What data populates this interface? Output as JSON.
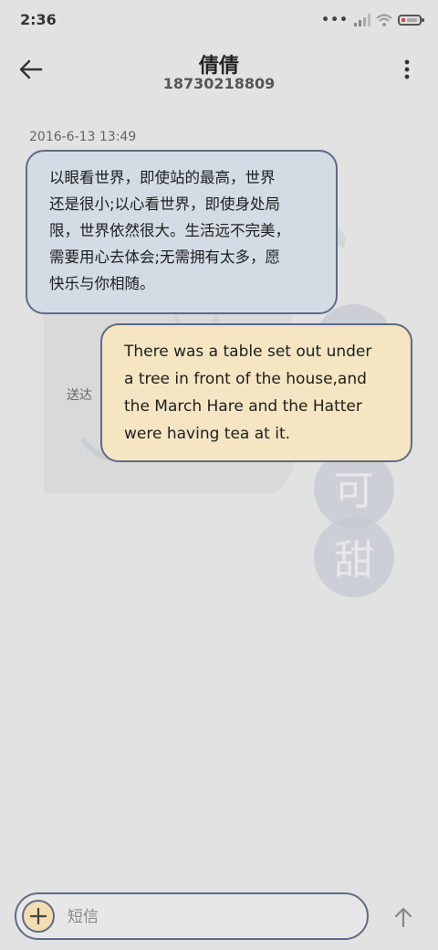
{
  "status_bar": {
    "time": "2:36"
  },
  "header": {
    "contact_name": "倩倩",
    "contact_number": "18730218809"
  },
  "conversation": {
    "timestamp": "2016-6-13 13:49",
    "messages": [
      {
        "direction": "incoming",
        "text": "以眼看世界，即使站的最高，世界\n还是很小;以心看世界，即使身处局\n限，世界依然很大。生活远不完美，\n需要用心去体会;无需拥有太多，愿\n快乐与你相随。"
      },
      {
        "direction": "outgoing",
        "text": "There was a table set out under\na tree in front of the house,and\nthe March Hare and the Hatter\nwere having tea at it.",
        "status": "送达"
      }
    ]
  },
  "background": {
    "chars": [
      "可",
      "甜"
    ]
  },
  "composer": {
    "placeholder": "短信"
  },
  "colors": {
    "accent": "#5e6b86",
    "incoming_bubble": "#d3dbe4",
    "outgoing_bubble": "#f5e5c2",
    "background": "#e2e2e2"
  },
  "icons": {
    "back": "arrow-left-icon",
    "more": "more-vertical-icon",
    "add": "plus-icon",
    "send": "arrow-up-icon",
    "signal": "signal-icon",
    "wifi": "wifi-icon",
    "battery": "battery-icon"
  }
}
